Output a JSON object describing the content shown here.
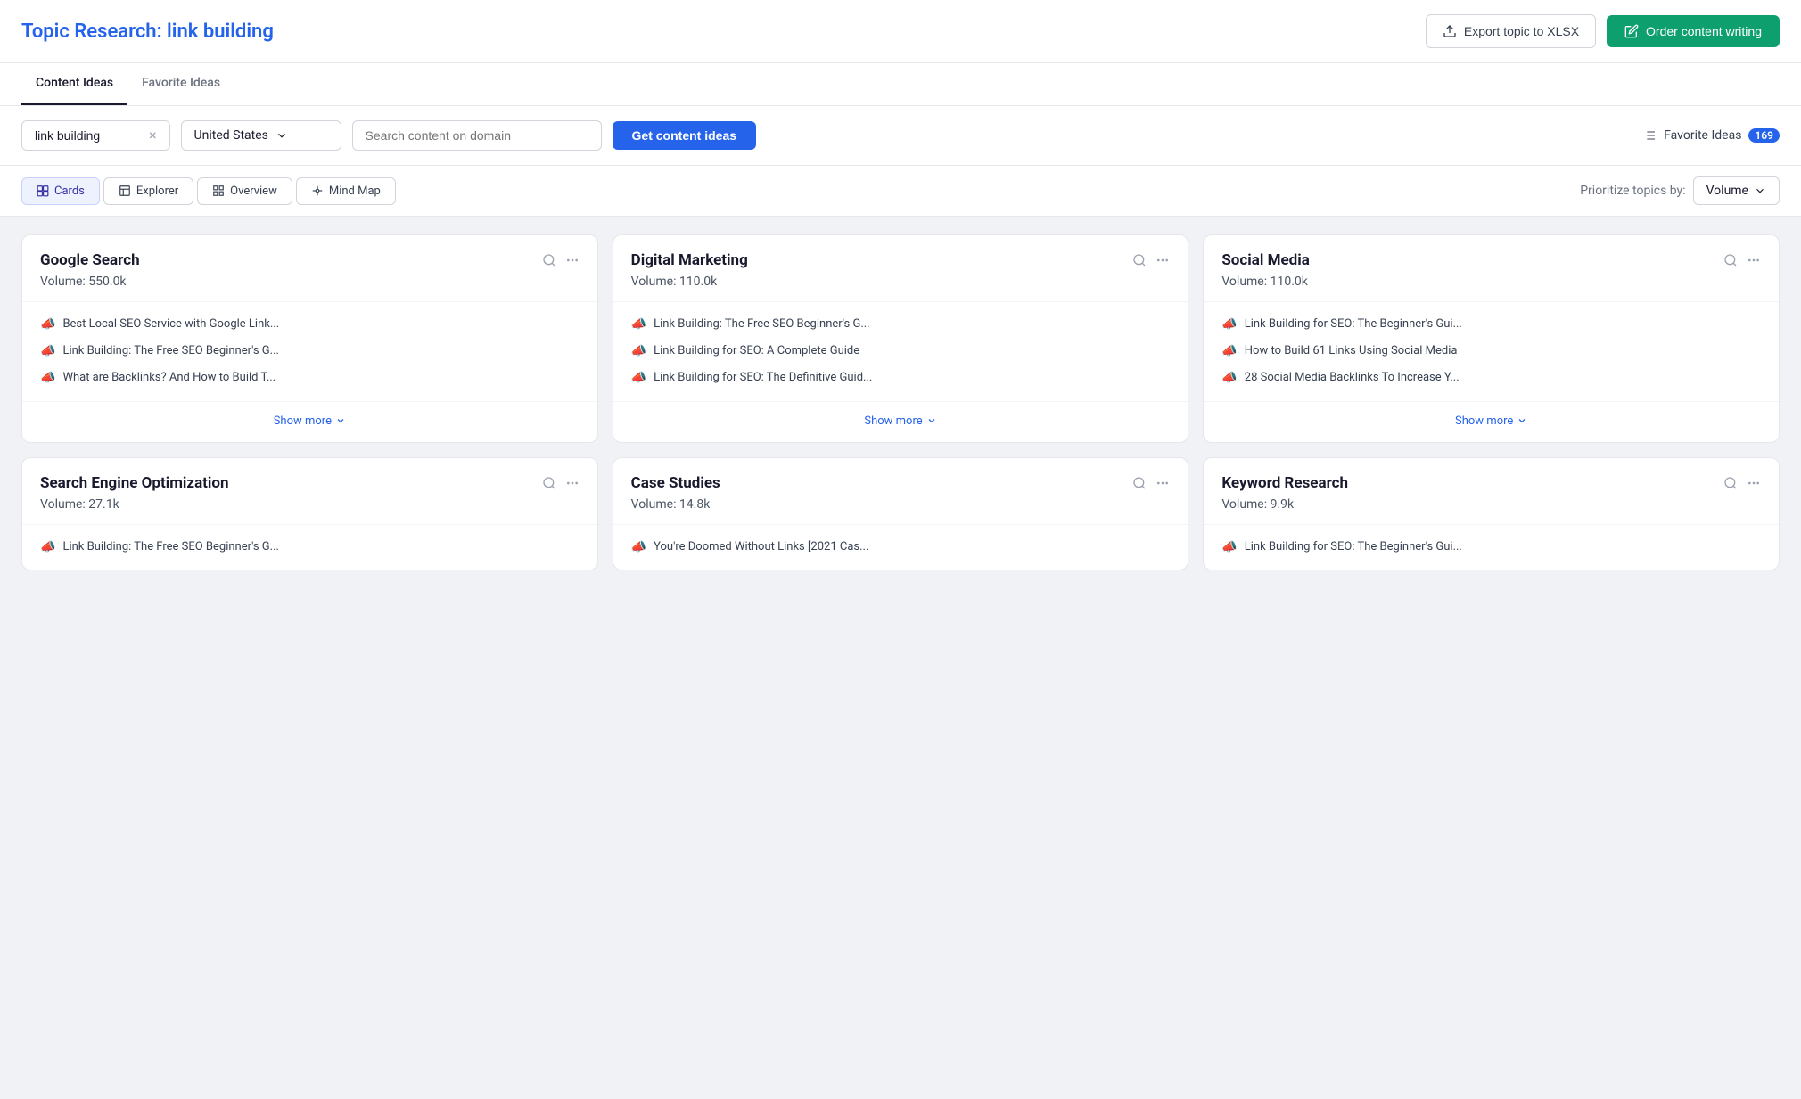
{
  "header": {
    "title_prefix": "Topic Research: ",
    "title_keyword": "link building",
    "export_label": "Export topic to XLSX",
    "order_label": "Order content writing"
  },
  "tabs": [
    {
      "id": "content-ideas",
      "label": "Content Ideas",
      "active": true
    },
    {
      "id": "favorite-ideas",
      "label": "Favorite Ideas",
      "active": false
    }
  ],
  "controls": {
    "keyword_value": "link building",
    "country_value": "United States",
    "domain_placeholder": "Search content on domain",
    "get_ideas_label": "Get content ideas",
    "favorite_label": "Favorite Ideas",
    "favorite_count": "169"
  },
  "view_tabs": [
    {
      "id": "cards",
      "label": "Cards",
      "active": true
    },
    {
      "id": "explorer",
      "label": "Explorer",
      "active": false
    },
    {
      "id": "overview",
      "label": "Overview",
      "active": false
    },
    {
      "id": "mind-map",
      "label": "Mind Map",
      "active": false
    }
  ],
  "prioritize": {
    "label": "Prioritize topics by:",
    "value": "Volume"
  },
  "cards": [
    {
      "id": "card-google-search",
      "title": "Google Search",
      "volume": "Volume: 550.0k",
      "items": [
        {
          "text": "Best Local SEO Service with Google Link...",
          "faded": false
        },
        {
          "text": "Link Building: The Free SEO Beginner's G...",
          "faded": false
        },
        {
          "text": "What are Backlinks? And How to Build T...",
          "faded": false
        }
      ],
      "show_more": "Show more"
    },
    {
      "id": "card-digital-marketing",
      "title": "Digital Marketing",
      "volume": "Volume: 110.0k",
      "items": [
        {
          "text": "Link Building: The Free SEO Beginner's G...",
          "faded": false
        },
        {
          "text": "Link Building for SEO: A Complete Guide",
          "faded": false
        },
        {
          "text": "Link Building for SEO: The Definitive Guid...",
          "faded": false
        }
      ],
      "show_more": "Show more"
    },
    {
      "id": "card-social-media",
      "title": "Social Media",
      "volume": "Volume: 110.0k",
      "items": [
        {
          "text": "Link Building for SEO: The Beginner's Gui...",
          "faded": false
        },
        {
          "text": "How to Build 61 Links Using Social Media",
          "faded": false
        },
        {
          "text": "28 Social Media Backlinks To Increase Y...",
          "faded": false
        }
      ],
      "show_more": "Show more"
    },
    {
      "id": "card-seo",
      "title": "Search Engine Optimization",
      "volume": "Volume: 27.1k",
      "items": [
        {
          "text": "Link Building: The Free SEO Beginner's G...",
          "faded": true
        }
      ],
      "show_more": ""
    },
    {
      "id": "card-case-studies",
      "title": "Case Studies",
      "volume": "Volume: 14.8k",
      "items": [
        {
          "text": "You're Doomed Without Links [2021 Cas...",
          "faded": true
        }
      ],
      "show_more": ""
    },
    {
      "id": "card-keyword-research",
      "title": "Keyword Research",
      "volume": "Volume: 9.9k",
      "items": [
        {
          "text": "Link Building for SEO: The Beginner's Gui...",
          "faded": true
        }
      ],
      "show_more": ""
    }
  ]
}
